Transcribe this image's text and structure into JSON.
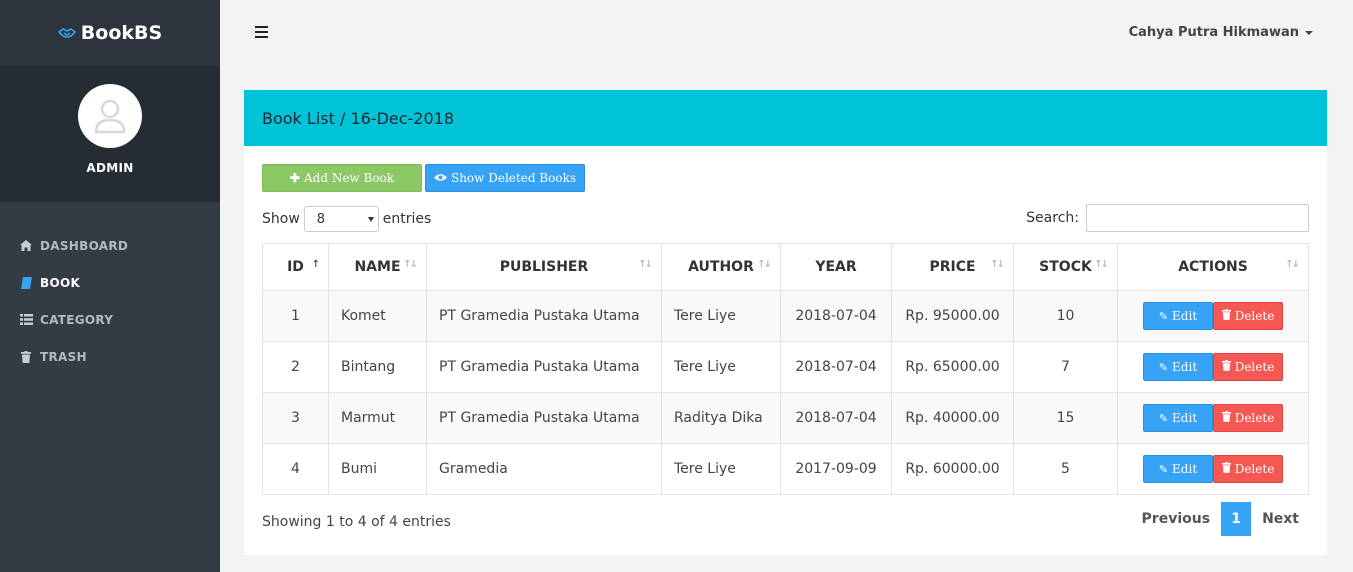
{
  "brand": {
    "name": "BookBS",
    "logo_icon": "handshake-icon"
  },
  "profile": {
    "name": "ADMIN"
  },
  "sidebar": {
    "items": [
      {
        "label": "DASHBOARD",
        "icon": "home-icon",
        "active": false
      },
      {
        "label": "BOOK",
        "icon": "book-icon",
        "active": true
      },
      {
        "label": "CATEGORY",
        "icon": "list-icon",
        "active": false
      },
      {
        "label": "TRASH",
        "icon": "trash-icon",
        "active": false
      }
    ]
  },
  "topbar": {
    "user_name": "Cahya Putra Hikmawan"
  },
  "panel": {
    "title": "Book List / 16-Dec-2018"
  },
  "toolbar": {
    "add_label": "Add New Book",
    "deleted_label": "Show Deleted Books"
  },
  "length": {
    "show_label": "Show",
    "value": "8",
    "entries_label": "entries"
  },
  "search": {
    "label": "Search:",
    "value": ""
  },
  "table": {
    "headers": [
      "ID",
      "NAME",
      "PUBLISHER",
      "AUTHOR",
      "YEAR",
      "PRICE",
      "STOCK",
      "ACTIONS"
    ],
    "rows": [
      {
        "id": "1",
        "name": "Komet",
        "publisher": "PT Gramedia Pustaka Utama",
        "author": "Tere Liye",
        "year": "2018-07-04",
        "price": "Rp. 95000.00",
        "stock": "10"
      },
      {
        "id": "2",
        "name": "Bintang",
        "publisher": "PT Gramedia Pustaka Utama",
        "author": "Tere Liye",
        "year": "2018-07-04",
        "price": "Rp. 65000.00",
        "stock": "7"
      },
      {
        "id": "3",
        "name": "Marmut",
        "publisher": "PT Gramedia Pustaka Utama",
        "author": "Raditya Dika",
        "year": "2018-07-04",
        "price": "Rp. 40000.00",
        "stock": "15"
      },
      {
        "id": "4",
        "name": "Bumi",
        "publisher": "Gramedia",
        "author": "Tere Liye",
        "year": "2017-09-09",
        "price": "Rp. 60000.00",
        "stock": "5"
      }
    ],
    "edit_label": "Edit",
    "delete_label": "Delete"
  },
  "footer": {
    "info": "Showing 1 to 4 of 4 entries",
    "previous": "Previous",
    "current_page": "1",
    "next": "Next"
  },
  "colors": {
    "accent": "#36a3f7",
    "header": "#00c3d8",
    "success": "#8cc865",
    "danger": "#f55753",
    "sidebar": "#333b45"
  }
}
